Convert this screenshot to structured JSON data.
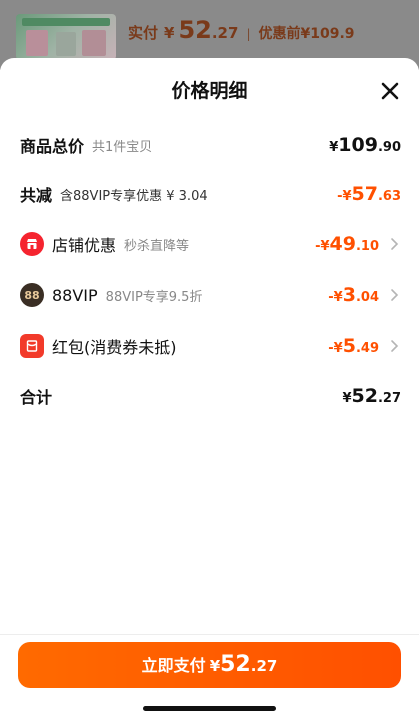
{
  "background": {
    "price_label": "实付",
    "currency": "¥",
    "price_int": "52",
    "price_dec": ".27",
    "separator": "|",
    "before_label": "优惠前¥109.9"
  },
  "sheet": {
    "title": "价格明细",
    "close_icon": "close-icon",
    "rows": [
      {
        "name": "商品总价",
        "sub": "共1件宝贝",
        "currency": "¥",
        "int": "109",
        "dec": ".90",
        "color": "#111111"
      },
      {
        "name": "共减",
        "sub": "含88VIP专享优惠 ¥ 3.04",
        "currency": "-¥",
        "int": "57",
        "dec": ".63",
        "color": "#ff5000"
      },
      {
        "name": "店铺优惠",
        "sub": "秒杀直降等",
        "currency": "-¥",
        "int": "49",
        "dec": ".10",
        "color": "#ff5000",
        "icon": "shop-icon"
      },
      {
        "name": "88VIP",
        "sub": "88VIP专享9.5折",
        "icon_text": "88",
        "currency": "-¥",
        "int": "3",
        "dec": ".04",
        "color": "#ff5000",
        "icon": "vip-badge-icon"
      },
      {
        "name": "红包(消费券未抵)",
        "currency": "-¥",
        "int": "5",
        "dec": ".49",
        "color": "#ff5000",
        "icon": "red-packet-icon"
      },
      {
        "name": "合计",
        "currency": "¥",
        "int": "52",
        "dec": ".27",
        "color": "#111111"
      }
    ]
  },
  "footer": {
    "pay_label": "立即支付",
    "currency": "¥",
    "int": "52",
    "dec": ".27",
    "button_color": "#ff5000"
  }
}
